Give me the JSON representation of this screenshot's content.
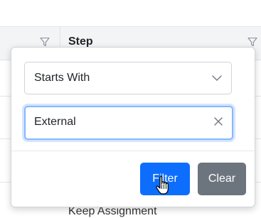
{
  "grid": {
    "column_title": "Step",
    "partial_row_text": "Keep Assignment"
  },
  "filter_popup": {
    "operator": {
      "selected": "Starts With"
    },
    "value_input": {
      "value": "External"
    },
    "buttons": {
      "filter_label": "Filter",
      "clear_label": "Clear"
    }
  },
  "colors": {
    "primary": "#0d6efd",
    "secondary": "#6c757d",
    "focus_border": "#86b7fe"
  },
  "icons": [
    "funnel-icon",
    "chevron-down-icon",
    "clear-x-icon",
    "hand-pointer-icon"
  ]
}
